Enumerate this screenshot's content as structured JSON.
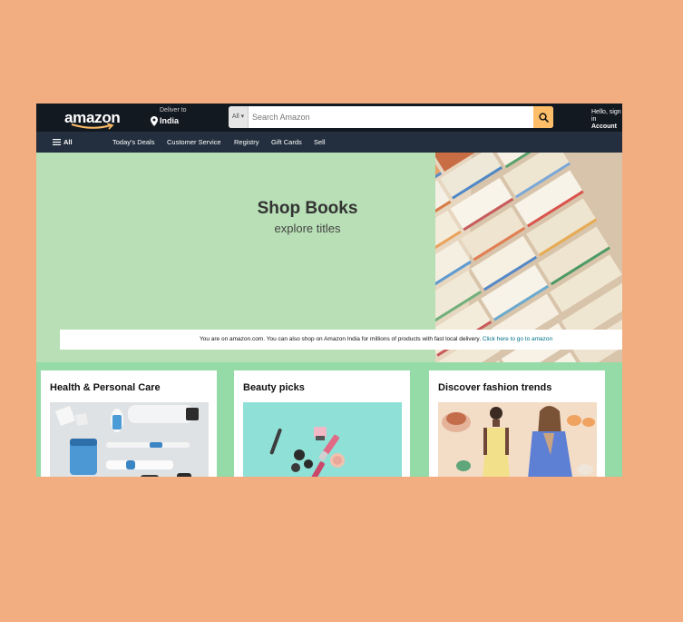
{
  "header": {
    "logo_text": "amazon",
    "deliver_to": "Deliver to",
    "location": "India",
    "search": {
      "category": "All",
      "placeholder": "Search Amazon"
    },
    "account_line1": "Hello, sign in",
    "account_line2": "Account"
  },
  "nav": {
    "all_label": "All",
    "items": [
      "Today's Deals",
      "Customer Service",
      "Registry",
      "Gift Cards",
      "Sell"
    ]
  },
  "hero": {
    "title": "Shop Books",
    "subtitle": "explore titles"
  },
  "notice": {
    "text": "You are on amazon.com. You can also shop on Amazon India for millions of products with fast local delivery.",
    "link": "Click here to go to amazon"
  },
  "cards": [
    {
      "title": "Health & Personal Care"
    },
    {
      "title": "Beauty picks"
    },
    {
      "title": "Discover fashion trends"
    }
  ],
  "colors": {
    "background": "#f2ad80",
    "header": "#131921",
    "subnav": "#232f3e",
    "hero": "#b8dfb6",
    "search_button": "#febd69"
  }
}
